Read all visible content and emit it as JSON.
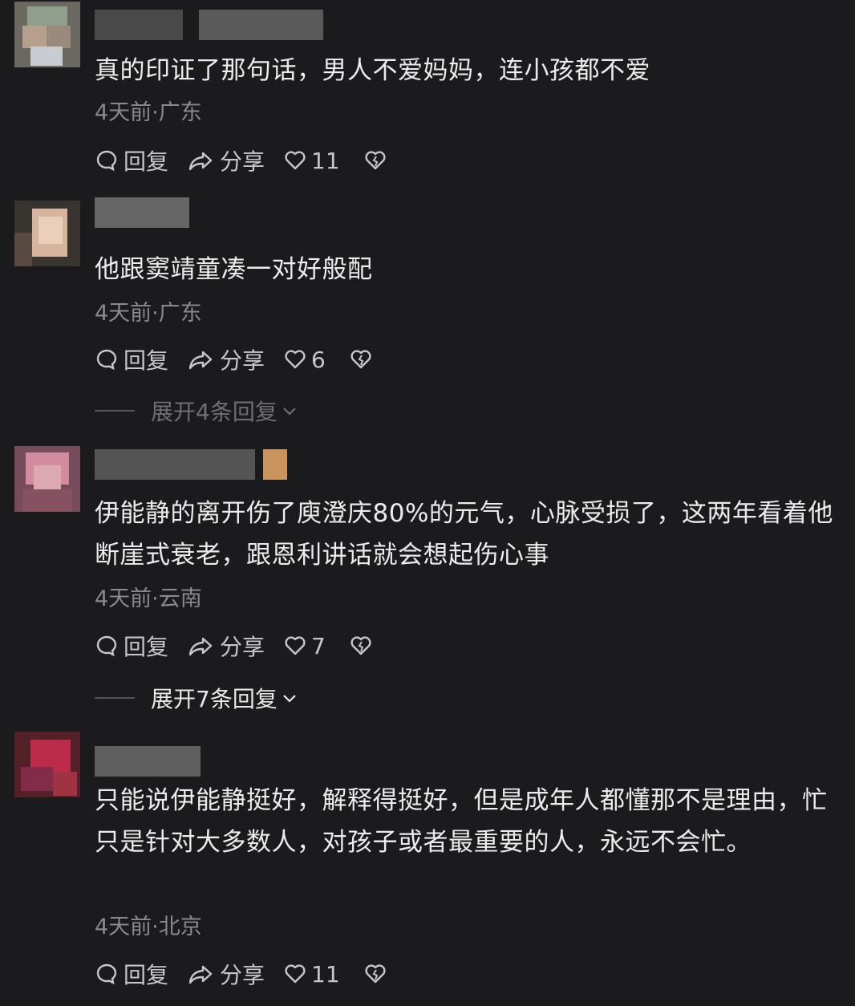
{
  "comments": [
    {
      "text": "真的印证了那句话，男人不爱妈妈，连小孩都不爱",
      "meta": "4天前·广东",
      "reply": "回复",
      "share": "分享",
      "likes": "11"
    },
    {
      "text": "他跟窦靖童凑一对好般配",
      "meta": "4天前·广东",
      "reply": "回复",
      "share": "分享",
      "likes": "6",
      "expand": "展开4条回复"
    },
    {
      "text": "伊能静的离开伤了庾澄庆80%的元气，心脉受损了，这两年看着他断崖式衰老，跟恩利讲话就会想起伤心事",
      "meta": "4天前·云南",
      "reply": "回复",
      "share": "分享",
      "likes": "7",
      "expand": "展开7条回复"
    },
    {
      "text": "只能说伊能静挺好，解释得挺好，但是成年人都懂那不是理由，忙只是针对大多数人，对孩子或者最重要的人，永远不会忙。",
      "meta": "4天前·北京",
      "reply": "回复",
      "share": "分享",
      "likes": "11"
    }
  ],
  "icons": {
    "reply": "speech-bubble-icon",
    "share": "share-arrow-icon",
    "like": "heart-icon",
    "dislike": "broken-heart-icon",
    "expand": "chevron-down-icon"
  }
}
